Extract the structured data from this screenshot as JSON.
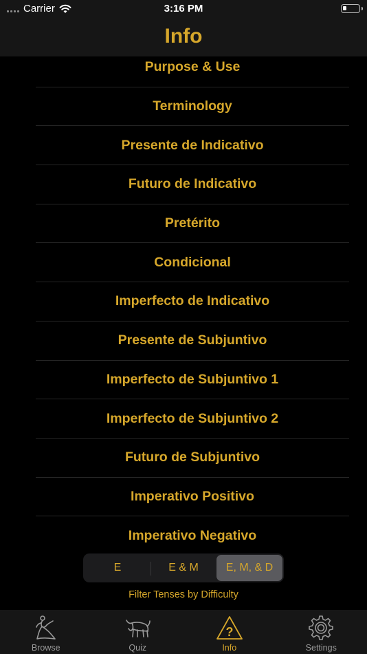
{
  "status_bar": {
    "carrier": "Carrier",
    "time": "3:16 PM"
  },
  "header": {
    "title": "Info"
  },
  "topics": [
    {
      "label": "Purpose & Use"
    },
    {
      "label": "Terminology"
    },
    {
      "label": "Presente de Indicativo"
    },
    {
      "label": "Futuro de Indicativo"
    },
    {
      "label": "Pretérito"
    },
    {
      "label": "Condicional"
    },
    {
      "label": "Imperfecto de Indicativo"
    },
    {
      "label": "Presente de Subjuntivo"
    },
    {
      "label": "Imperfecto de Subjuntivo 1"
    },
    {
      "label": "Imperfecto de Subjuntivo 2"
    },
    {
      "label": "Futuro de Subjuntivo"
    },
    {
      "label": "Imperativo Positivo"
    },
    {
      "label": "Imperativo Negativo"
    }
  ],
  "difficulty": {
    "options": [
      {
        "label": "E"
      },
      {
        "label": "E & M"
      },
      {
        "label": "E, M, & D"
      }
    ],
    "selected": "E, M, & D",
    "caption": "Filter Tenses by Difficulty"
  },
  "tabs": [
    {
      "label": "Browse",
      "icon": "dancer-icon"
    },
    {
      "label": "Quiz",
      "icon": "bull-icon"
    },
    {
      "label": "Info",
      "icon": "question-triangle-icon"
    },
    {
      "label": "Settings",
      "icon": "gear-icon"
    }
  ],
  "active_tab": "Info",
  "colors": {
    "accent": "#d6a72b",
    "bar_background": "#161616",
    "inactive": "#9a9a9a"
  }
}
